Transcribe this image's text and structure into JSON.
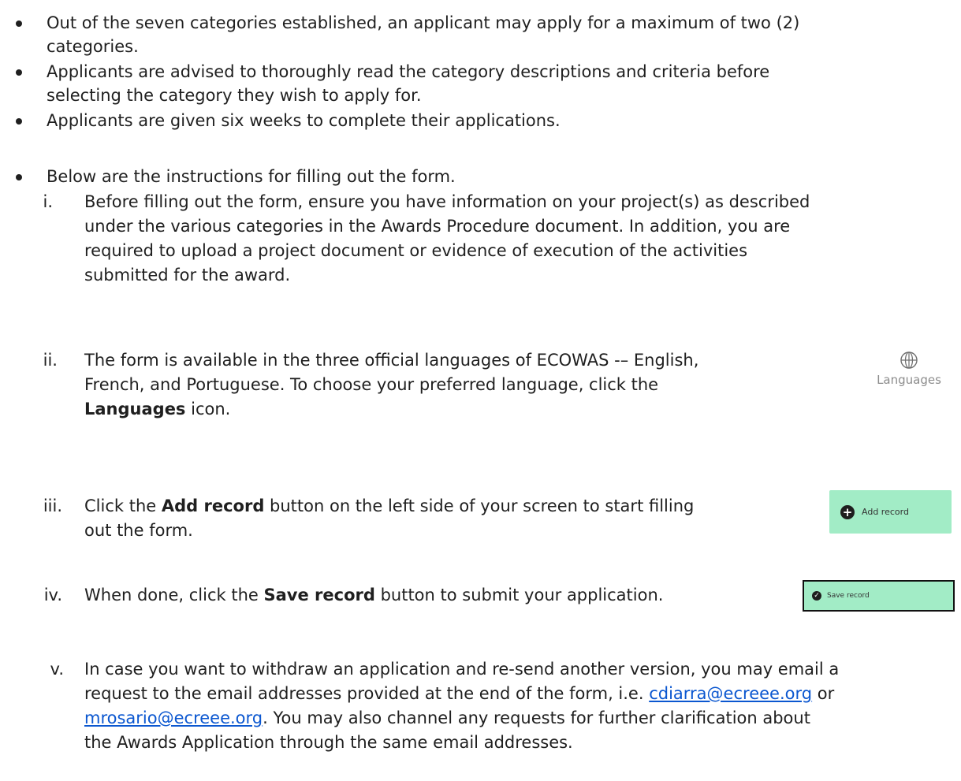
{
  "bullets": [
    {
      "lines": [
        "Out of the seven categories established, an applicant may apply for a maximum of two (2)",
        "categories."
      ]
    },
    {
      "lines": [
        "Applicants are advised to thoroughly read the category descriptions and criteria before",
        "selecting the category they wish to apply for."
      ]
    },
    {
      "lines": [
        "Applicants are given six weeks to complete their applications."
      ]
    },
    {
      "lines": [
        "Below are the instructions for filling out the form."
      ]
    }
  ],
  "steps": {
    "i": {
      "num": "i.",
      "lines": [
        "Before filling out the form, ensure you have information on your project(s) as described",
        "under the various categories in the Awards Procedure document. In addition, you are",
        "required to upload a project document or evidence of execution of the activities",
        "submitted for the award."
      ]
    },
    "ii": {
      "num": "ii.",
      "line1": "The form is available in the three official languages of ECOWAS -– English,",
      "line2": "French, and Portuguese. To choose your preferred language, click the",
      "bold": "Languages",
      "after_bold": " icon."
    },
    "iii": {
      "num": "iii.",
      "before_bold": "Click the ",
      "bold": "Add record",
      "after_bold": " button on the left side of your screen to start filling",
      "line2": "out the form."
    },
    "iv": {
      "num": "iv.",
      "before_bold": "When done, click the ",
      "bold": "Save record",
      "after_bold": " button to submit your application."
    },
    "v": {
      "num": "v.",
      "line1": "In case you want to withdraw an application and re-send another version, you may email a",
      "line2_before": "request to the email addresses provided at the end of the form, i.e. ",
      "email1": "cdiarra@ecreee.org",
      "line2_after": " or",
      "email2": "mrosario@ecreee.org",
      "line3_after": ". You may also channel any requests for further clarification about",
      "line4": "the Awards Application through the same email addresses."
    }
  },
  "widgets": {
    "languages_label": "Languages",
    "add_record_label": "Add record",
    "add_record_icon": "plus-circle-icon",
    "save_record_label": "Save record",
    "save_record_icon": "check-circle-icon",
    "button_bg": "#a2ecc6"
  }
}
